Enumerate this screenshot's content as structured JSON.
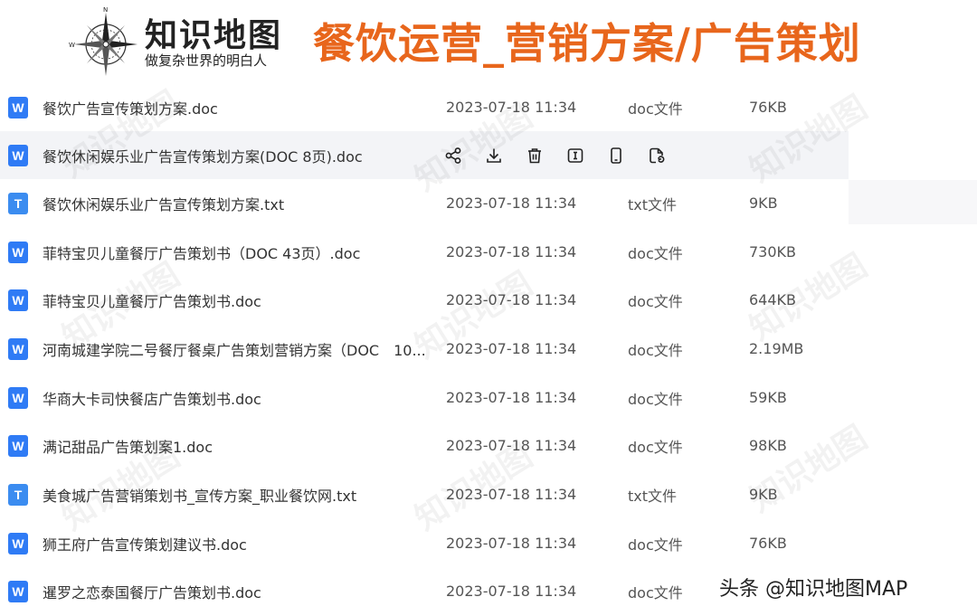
{
  "header": {
    "logo_title": "知识地图",
    "logo_slogan": "做复杂世界的明白人",
    "main_title": "餐饮运营_营销方案/广告策划"
  },
  "files": [
    {
      "icon": "W",
      "name": "餐饮广告宣传策划方案.doc",
      "date": "2023-07-18 11:34",
      "type": "doc文件",
      "size": "76KB"
    },
    {
      "icon": "W",
      "name": "餐饮休闲娱乐业广告宣传策划方案(DOC 8页).doc",
      "date": "",
      "type": "",
      "size": ""
    },
    {
      "icon": "T",
      "name": "餐饮休闲娱乐业广告宣传策划方案.txt",
      "date": "2023-07-18 11:34",
      "type": "txt文件",
      "size": "9KB"
    },
    {
      "icon": "W",
      "name": "菲特宝贝儿童餐厅广告策划书（DOC 43页）.doc",
      "date": "2023-07-18 11:34",
      "type": "doc文件",
      "size": "730KB"
    },
    {
      "icon": "W",
      "name": "菲特宝贝儿童餐厅广告策划书.doc",
      "date": "2023-07-18 11:34",
      "type": "doc文件",
      "size": "644KB"
    },
    {
      "icon": "W",
      "name": "河南城建学院二号餐厅餐桌广告策划营销方案（DOC　10...",
      "date": "2023-07-18 11:34",
      "type": "doc文件",
      "size": "2.19MB"
    },
    {
      "icon": "W",
      "name": "华商大卡司快餐店广告策划书.doc",
      "date": "2023-07-18 11:34",
      "type": "doc文件",
      "size": "59KB"
    },
    {
      "icon": "W",
      "name": "满记甜品广告策划案1.doc",
      "date": "2023-07-18 11:34",
      "type": "doc文件",
      "size": "98KB"
    },
    {
      "icon": "T",
      "name": "美食城广告营销策划书_宣传方案_职业餐饮网.txt",
      "date": "2023-07-18 11:34",
      "type": "txt文件",
      "size": "9KB"
    },
    {
      "icon": "W",
      "name": "狮王府广告宣传策划建议书.doc",
      "date": "2023-07-18 11:34",
      "type": "doc文件",
      "size": "76KB"
    },
    {
      "icon": "W",
      "name": "暹罗之恋泰国餐厅广告策划书.doc",
      "date": "2023-07-18 11:34",
      "type": "doc文件",
      "size": ""
    }
  ],
  "hover_actions": [
    "share-icon",
    "download-icon",
    "delete-icon",
    "rename-icon",
    "mobile-icon",
    "copy-icon"
  ],
  "watermark": {
    "repeated": "知识地图",
    "bottom_text": "头条 @知识地图MAP"
  },
  "colors": {
    "accent": "#e8661c",
    "doc_icon": "#2f7bf5",
    "hover_row": "#f3f4f7"
  }
}
